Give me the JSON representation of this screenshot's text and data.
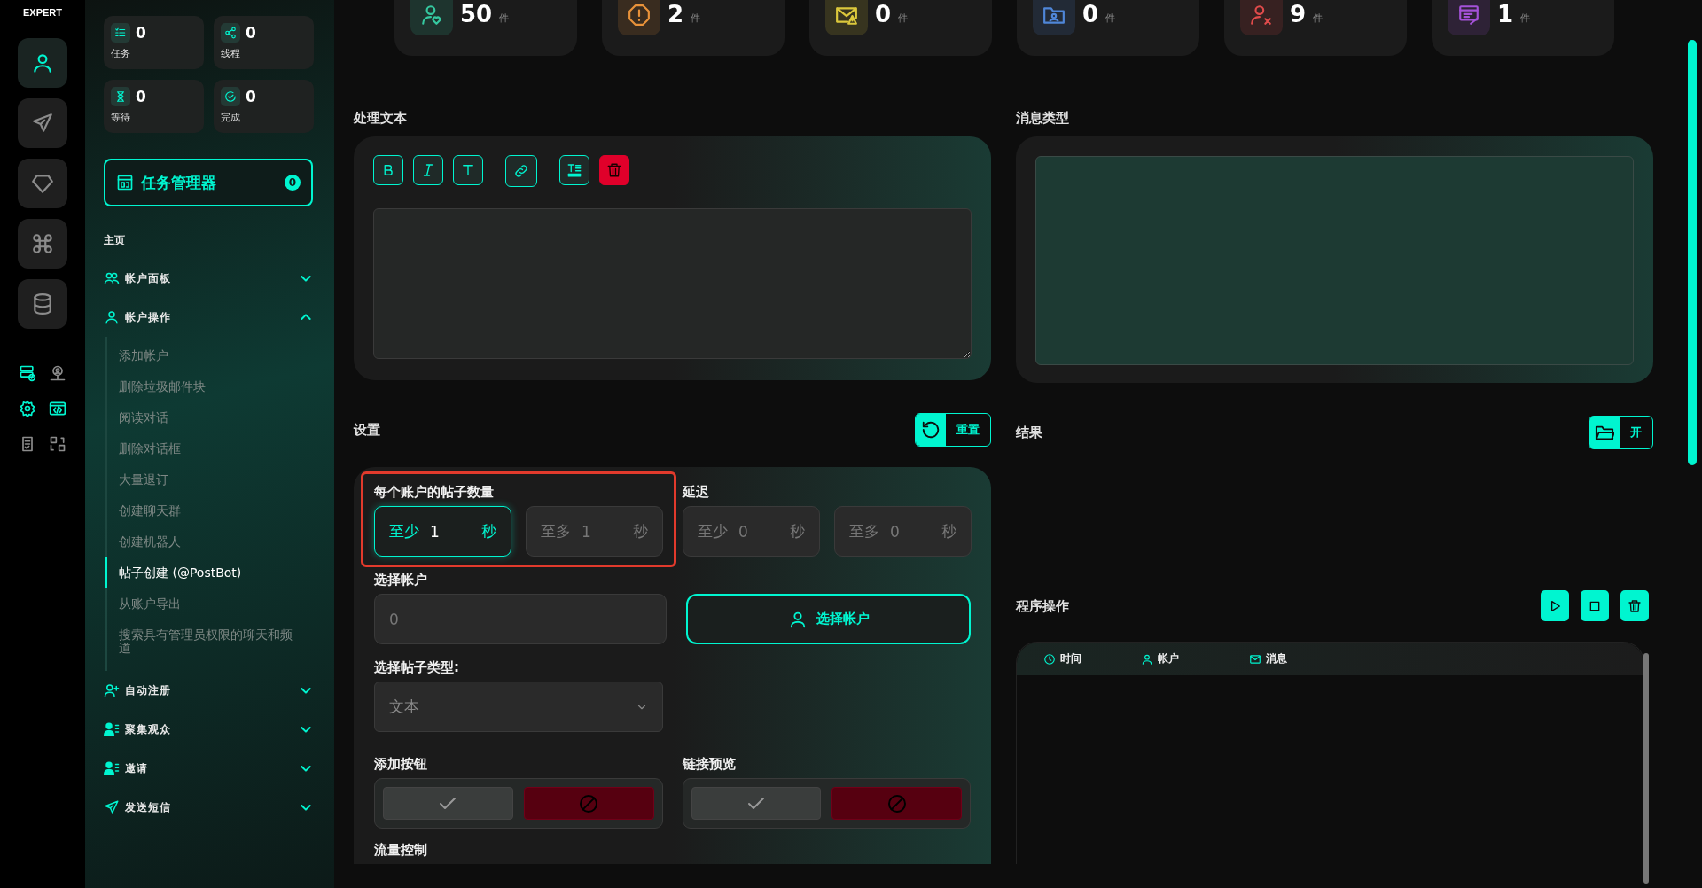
{
  "rail": {
    "logo": "EXPERT",
    "buttons": [
      {
        "selected": true
      },
      {
        "selected": false
      },
      {
        "selected": false
      },
      {
        "selected": false
      },
      {
        "selected": false
      }
    ]
  },
  "sidebar": {
    "stats": [
      {
        "value": "0",
        "label": "任务"
      },
      {
        "value": "0",
        "label": "线程"
      },
      {
        "value": "0",
        "label": "等待"
      },
      {
        "value": "0",
        "label": "完成"
      }
    ],
    "task_manager": {
      "label": "任务管理器",
      "count": "0"
    },
    "home": "主页",
    "groups": [
      {
        "label": "帐户面板",
        "expanded": false
      },
      {
        "label": "帐户操作",
        "expanded": true,
        "children": [
          {
            "label": "添加帐户",
            "selected": false
          },
          {
            "label": "删除垃圾邮件块",
            "selected": false
          },
          {
            "label": "阅读对话",
            "selected": false
          },
          {
            "label": "删除对话框",
            "selected": false
          },
          {
            "label": "大量退订",
            "selected": false
          },
          {
            "label": "创建聊天群",
            "selected": false
          },
          {
            "label": "创建机器人",
            "selected": false
          },
          {
            "label": "帖子创建 (@PostBot)",
            "selected": true
          },
          {
            "label": "从账户导出",
            "selected": false
          },
          {
            "label": "搜索具有管理员权限的聊天和频道",
            "selected": false
          }
        ]
      },
      {
        "label": "自动注册",
        "expanded": false
      },
      {
        "label": "聚集观众",
        "expanded": false
      },
      {
        "label": "邀请",
        "expanded": false
      },
      {
        "label": "发送短信",
        "expanded": false
      }
    ]
  },
  "top_stats": [
    {
      "value": "50",
      "unit": "件",
      "color": "#35c9a0"
    },
    {
      "value": "2",
      "unit": "件",
      "color": "#e8923a"
    },
    {
      "value": "0",
      "unit": "件",
      "color": "#dcc83c"
    },
    {
      "value": "0",
      "unit": "件",
      "color": "#4f86d8"
    },
    {
      "value": "9",
      "unit": "件",
      "color": "#e04b4b"
    },
    {
      "value": "1",
      "unit": "件",
      "color": "#a452d8"
    }
  ],
  "text_panel": {
    "title": "处理文本"
  },
  "message_type": {
    "title": "消息类型"
  },
  "settings": {
    "title": "设置",
    "reset_label": "重置",
    "posts_per_account": {
      "label": "每个账户的帖子数量",
      "highlighted": true,
      "fields": [
        {
          "prefix": "至少",
          "value": "1",
          "unit": "秒",
          "focused": true
        },
        {
          "prefix": "至多",
          "value": "1",
          "unit": "秒",
          "focused": false
        }
      ]
    },
    "delay": {
      "label": "延迟",
      "fields": [
        {
          "prefix": "至少",
          "value": "0",
          "unit": "秒",
          "focused": false
        },
        {
          "prefix": "至多",
          "value": "0",
          "unit": "秒",
          "focused": false
        }
      ]
    },
    "select_account": {
      "label": "选择帐户",
      "value": "0",
      "button": "选择帐户"
    },
    "post_type": {
      "label": "选择帖子类型:",
      "value": "文本"
    },
    "toggles": [
      {
        "label": "添加按钮"
      },
      {
        "label": "链接预览"
      }
    ],
    "next_label": "流量控制"
  },
  "results": {
    "title": "结果",
    "open_label": "开"
  },
  "program": {
    "title": "程序操作",
    "columns": [
      "时间",
      "帐户",
      "消息"
    ]
  }
}
